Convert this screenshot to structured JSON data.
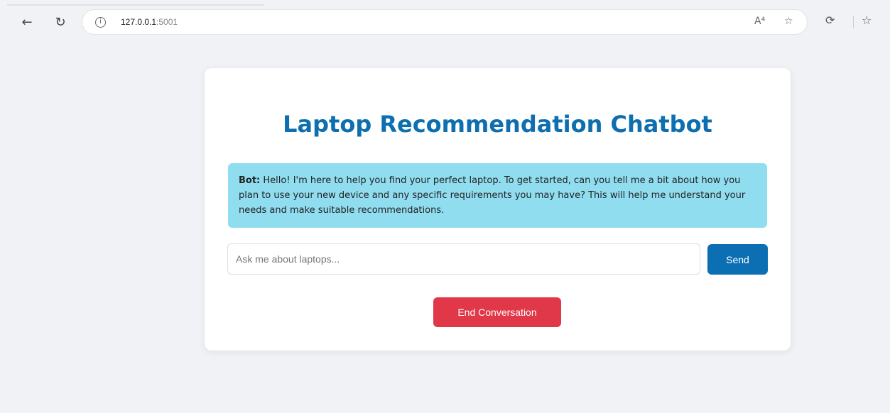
{
  "browser": {
    "url_host": "127.0.0.1",
    "url_port": ":5001",
    "icons": {
      "back": "arrow-left-icon",
      "refresh": "refresh-icon",
      "info": "info-icon",
      "read_aloud": "read-aloud-icon",
      "favorite": "star-icon",
      "extensions": "extensions-icon",
      "favorites_bar": "favorites-icon"
    },
    "read_aloud_label": "A⁴",
    "info_glyph": "i"
  },
  "chat": {
    "title": "Laptop Recommendation Chatbot",
    "messages": [
      {
        "sender": "Bot:",
        "text": " Hello! I'm here to help you find your perfect laptop. To get started, can you tell me a bit about how you plan to use your new device and any specific requirements you may have? This will help me understand your needs and make suitable recommendations."
      }
    ],
    "input_placeholder": "Ask me about laptops...",
    "input_value": "",
    "send_label": "Send",
    "end_label": "End Conversation"
  },
  "colors": {
    "title": "#0d6fb0",
    "bot_bubble": "#90ddf0",
    "send_button": "#0c6fb3",
    "end_button": "#e03848",
    "page_background": "#f0f2f5"
  }
}
